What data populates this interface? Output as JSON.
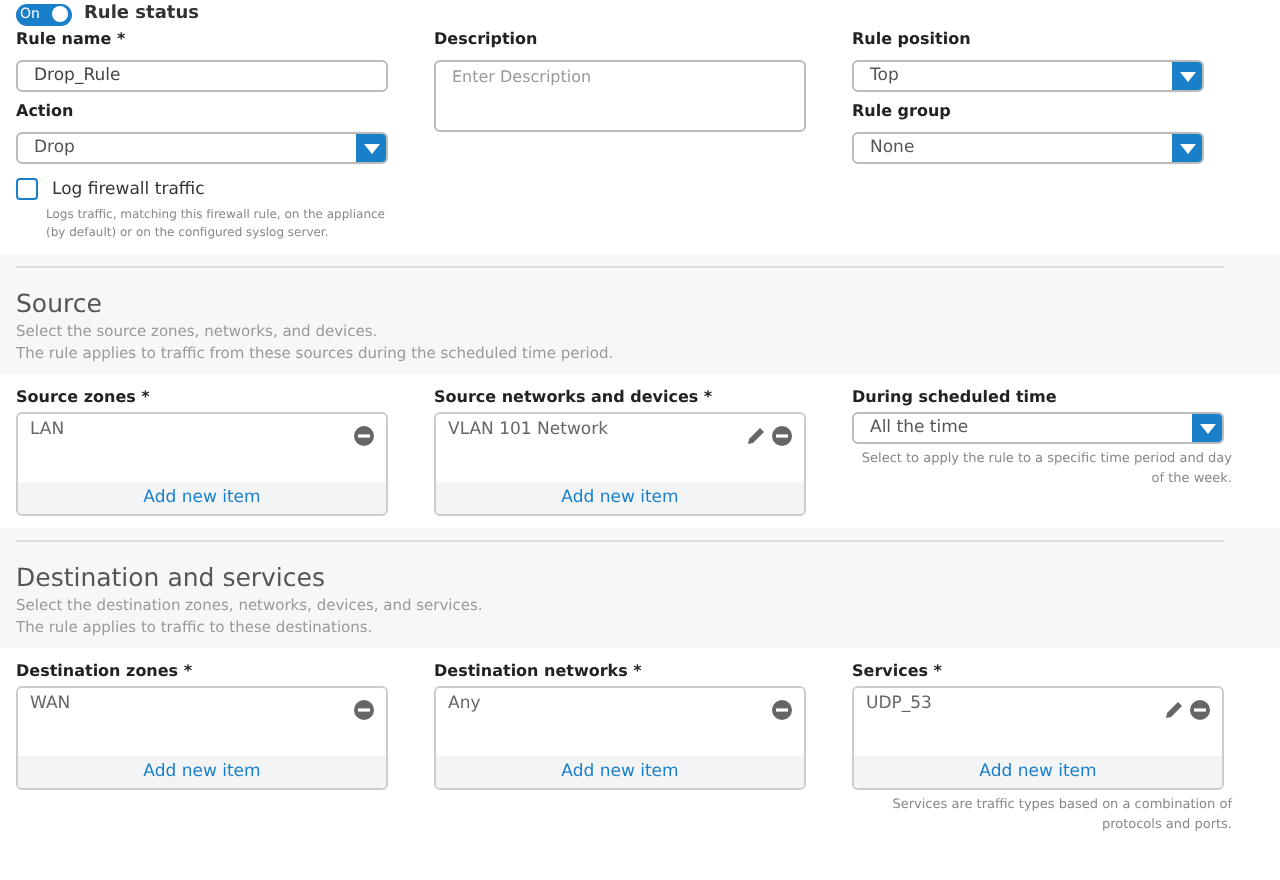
{
  "rule_status": {
    "toggle_text": "On",
    "on": true,
    "label": "Rule status"
  },
  "rule_name": {
    "label": "Rule name *",
    "value": "Drop_Rule"
  },
  "action": {
    "label": "Action",
    "value": "Drop"
  },
  "log_traffic": {
    "label": "Log firewall traffic",
    "checked": false,
    "hint": "Logs traffic, matching this firewall rule, on the appliance (by default) or on the configured syslog server."
  },
  "description": {
    "label": "Description",
    "placeholder": "Enter Description"
  },
  "rule_position": {
    "label": "Rule position",
    "value": "Top"
  },
  "rule_group": {
    "label": "Rule group",
    "value": "None"
  },
  "sections": [
    {
      "title": "Source",
      "lines": [
        "Select the source zones, networks, and devices.",
        "The rule applies to traffic from these sources during the scheduled time period."
      ],
      "fields": [
        {
          "kind": "list",
          "label": "Source zones *",
          "items": [
            {
              "text": "LAN",
              "editable": false
            }
          ],
          "add_label": "Add new item"
        },
        {
          "kind": "list",
          "label": "Source networks and devices *",
          "items": [
            {
              "text": "VLAN 101 Network",
              "editable": true
            }
          ],
          "add_label": "Add new item"
        },
        {
          "kind": "select",
          "label": "During scheduled time",
          "value": "All the time",
          "hint": "Select to apply the rule to a specific time period and day of the week."
        }
      ]
    },
    {
      "title": "Destination and services",
      "lines": [
        "Select the destination zones, networks, devices, and services.",
        "The rule applies to traffic to these destinations."
      ],
      "fields": [
        {
          "kind": "list",
          "label": "Destination zones *",
          "items": [
            {
              "text": "WAN",
              "editable": false
            }
          ],
          "add_label": "Add new item"
        },
        {
          "kind": "list",
          "label": "Destination networks *",
          "items": [
            {
              "text": "Any",
              "editable": false
            }
          ],
          "add_label": "Add new item"
        },
        {
          "kind": "list",
          "label": "Services *",
          "items": [
            {
              "text": "UDP_53",
              "editable": true
            }
          ],
          "add_label": "Add new item",
          "hint": "Services are traffic types based on a combination of protocols and ports."
        }
      ]
    }
  ]
}
